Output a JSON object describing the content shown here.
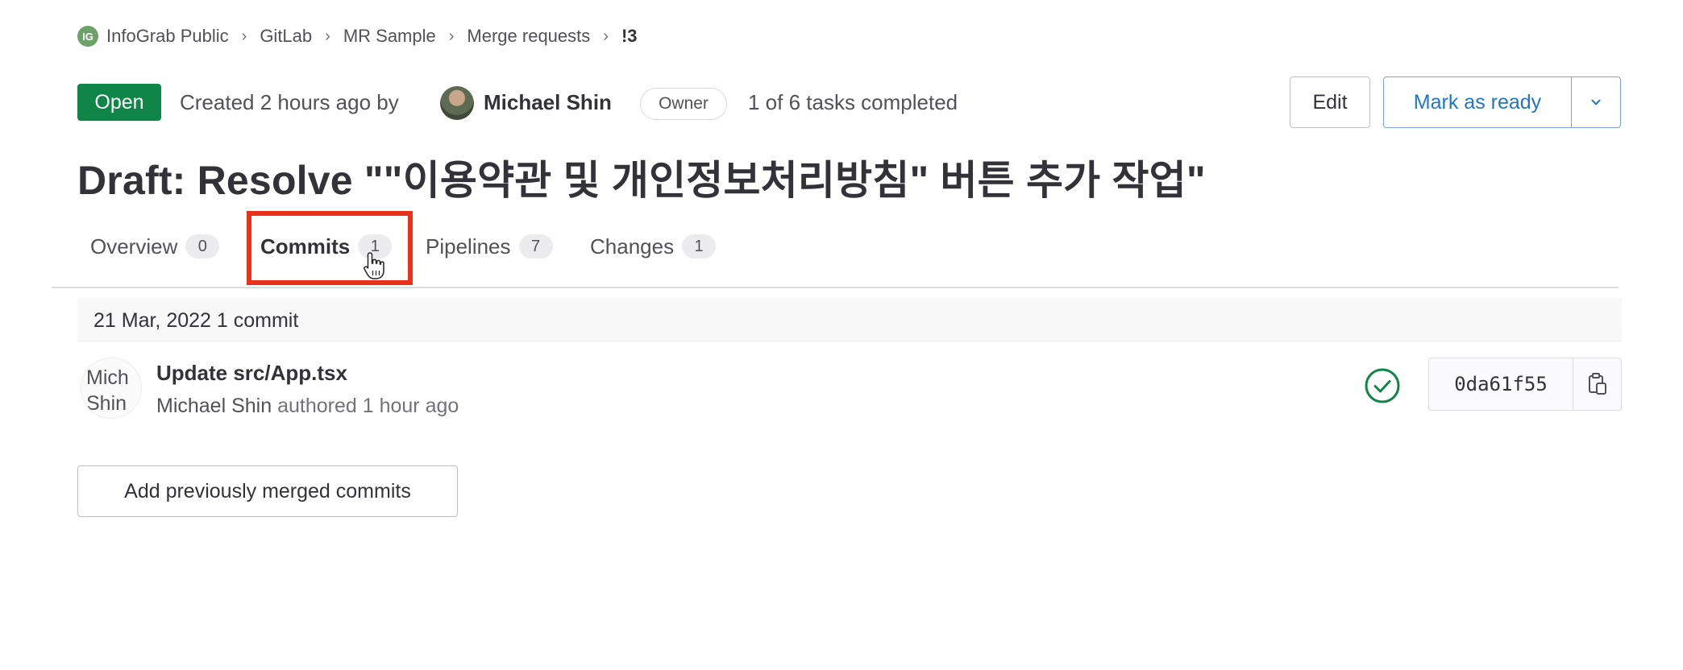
{
  "breadcrumb": {
    "logo_initials": "IG",
    "items": [
      "InfoGrab Public",
      "GitLab",
      "MR Sample",
      "Merge requests",
      "!3"
    ],
    "separator": "›"
  },
  "header": {
    "status": "Open",
    "created_text": "Created 2 hours ago by",
    "author": "Michael Shin",
    "role_badge": "Owner",
    "tasks": "1 of 6 tasks completed",
    "edit_label": "Edit",
    "ready_label": "Mark as ready",
    "toggle_icon": "chevron-down-icon"
  },
  "title": "Draft: Resolve \"\"이용약관 및 개인정보처리방침\" 버튼 추가 작업\"",
  "tabs": [
    {
      "label": "Overview",
      "count": "0"
    },
    {
      "label": "Commits",
      "count": "1"
    },
    {
      "label": "Pipelines",
      "count": "7"
    },
    {
      "label": "Changes",
      "count": "1"
    }
  ],
  "active_tab": "Commits",
  "commits": {
    "date_header": "21 Mar, 2022 1 commit",
    "avatar_text_line1": "Mich",
    "avatar_text_line2": "Shin",
    "title": "Update src/App.tsx",
    "author": "Michael Shin",
    "meta": "authored 1 hour ago",
    "sha": "0da61f55",
    "pipeline_status": "passed"
  },
  "add_commits_label": "Add previously merged commits",
  "colors": {
    "status_open": "#108548",
    "accent_blue": "#1f75cb",
    "highlight": "#e8321c",
    "success": "#108548"
  }
}
